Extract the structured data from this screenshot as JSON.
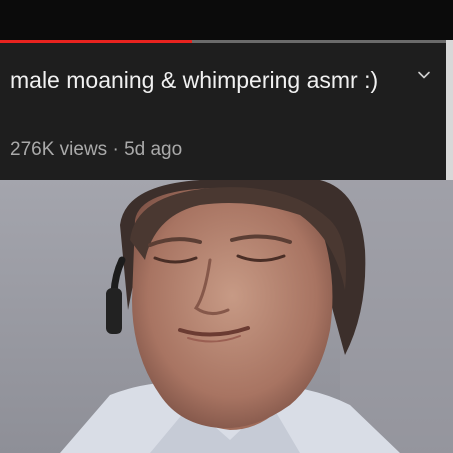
{
  "player": {
    "progress_fraction": 0.43,
    "progress_color": "#e8231f"
  },
  "video": {
    "title": "male moaning & whimpering asmr :)",
    "views": "276K views",
    "separator": "·",
    "age": "5d ago"
  },
  "controls": {
    "expand_icon": "chevron-down-icon"
  },
  "thumbnail": {
    "subject": "man in white shirt with eyes closed"
  }
}
